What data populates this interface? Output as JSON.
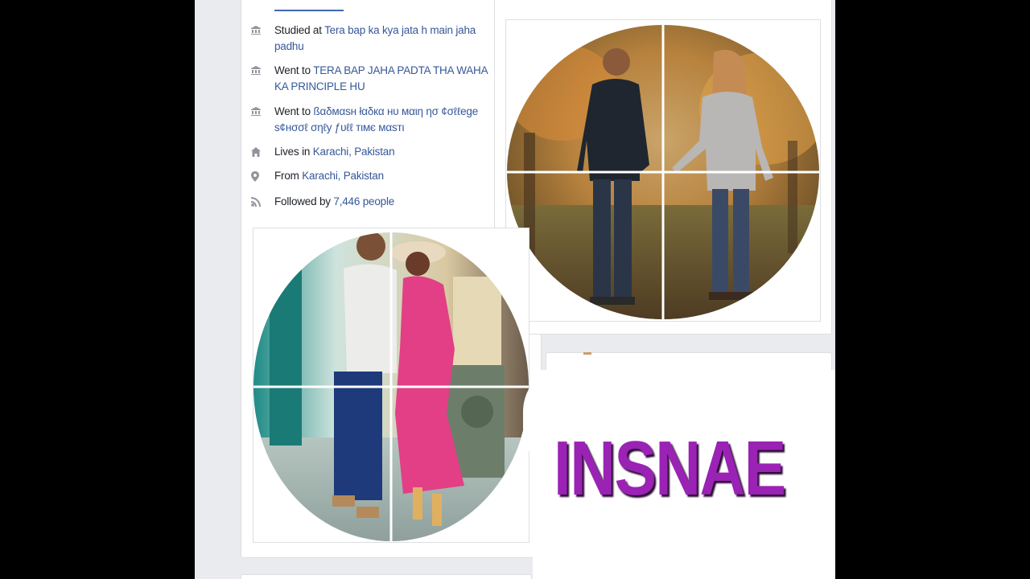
{
  "intro": {
    "items": [
      {
        "icon": "school-icon",
        "prefix": "Studied at ",
        "link": "Tera bap ka kya jata h main jaha padhu"
      },
      {
        "icon": "school-icon",
        "prefix": "Went to ",
        "link": "TERA BAP JAHA PADTA THA WAHA KA PRINCIPLE HU"
      },
      {
        "icon": "school-icon",
        "prefix": "Went to ",
        "link": "ßαδмαѕн łαδкα нυ мαιη ησ ¢σℓℓege ѕ¢нσσℓ σηℓу ƒυℓℓ тιмє мαѕтι"
      },
      {
        "icon": "home-icon",
        "prefix": "Lives in ",
        "link": "Karachi, Pakistan"
      },
      {
        "icon": "location-pin-icon",
        "prefix": "From ",
        "link": "Karachi, Pakistan"
      },
      {
        "icon": "rss-icon",
        "prefix": "Followed by ",
        "link": "7,446 people"
      }
    ]
  },
  "watermark": {
    "text": "INSNAE"
  },
  "colors": {
    "link": "#365899",
    "text": "#1d2129",
    "watermark": "#9a22b4",
    "background": "#e9ebee"
  }
}
